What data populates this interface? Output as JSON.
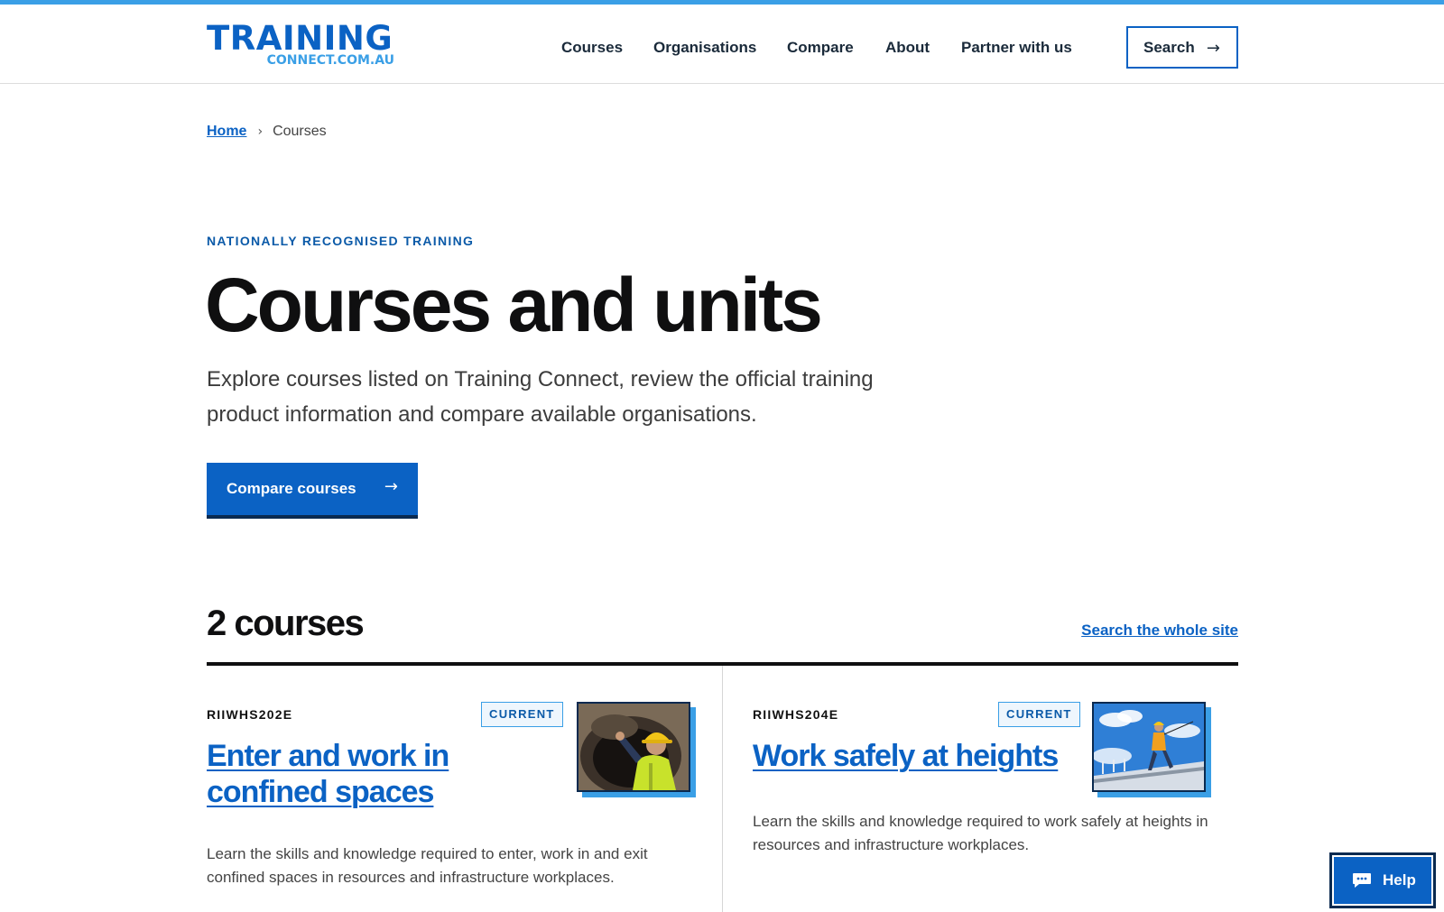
{
  "header": {
    "logo_main": "TRAINING",
    "logo_sub": "CONNECT.COM.AU",
    "nav": [
      "Courses",
      "Organisations",
      "Compare",
      "About",
      "Partner with us"
    ],
    "search_label": "Search"
  },
  "breadcrumb": {
    "home": "Home",
    "separator": "›",
    "current": "Courses"
  },
  "hero": {
    "eyebrow": "NATIONALLY RECOGNISED TRAINING",
    "title": "Courses and units",
    "lead": "Explore courses listed on Training Connect, review the official training product information and compare available organisations.",
    "cta_label": "Compare courses"
  },
  "results": {
    "count": "2 courses",
    "search_site_link": "Search the whole site",
    "courses": [
      {
        "code": "RIIWHS202E",
        "status": "CURRENT",
        "title": "Enter and work in confined spaces",
        "description": "Learn the skills and knowledge required to enter, work in and exit confined spaces in resources and infrastructure workplaces."
      },
      {
        "code": "RIIWHS204E",
        "status": "CURRENT",
        "title": "Work safely at heights",
        "description": "Learn the skills and knowledge required to work safely at heights in resources and infrastructure workplaces."
      }
    ]
  },
  "help": {
    "label": "Help"
  },
  "colors": {
    "brand": "#0b62c4",
    "accent": "#3a9fe6",
    "dark": "#0a2a50"
  },
  "icons": {
    "arrow": "arrow-right-icon",
    "chat": "chat-bubble-icon"
  }
}
